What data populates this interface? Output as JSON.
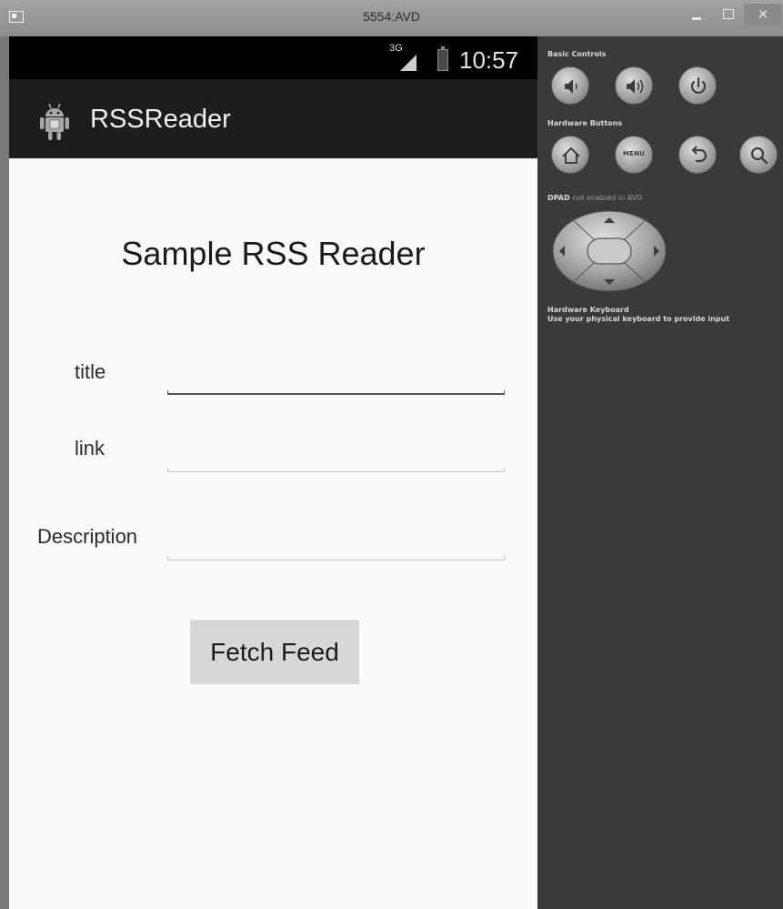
{
  "window": {
    "title": "5554:AVD",
    "close_glyph": "×"
  },
  "device": {
    "status_bar": {
      "network": "3G",
      "time": "10:57"
    },
    "action_bar": {
      "app_title": "RSSReader",
      "icon": "android-robot-icon"
    },
    "heading": "Sample RSS Reader",
    "form": {
      "fields": [
        {
          "label": "title",
          "value": ""
        },
        {
          "label": "link",
          "value": ""
        },
        {
          "label": "Description",
          "value": ""
        }
      ],
      "fetch_button_label": "Fetch Feed"
    }
  },
  "controls": {
    "basic_controls_label": "Basic Controls",
    "hardware_buttons_label": "Hardware Buttons",
    "dpad_label": "DPAD",
    "dpad_note": "not enabled in AVD",
    "keyboard_label": "Hardware Keyboard",
    "keyboard_note": "Use your physical keyboard to provide input",
    "menu_label": "MENU",
    "basic_buttons": [
      "volume-down-icon",
      "volume-up-icon",
      "power-icon"
    ],
    "hardware_buttons": [
      "home-icon",
      "menu-icon",
      "back-icon",
      "search-icon"
    ]
  },
  "colors": {
    "device_background": "#fafafa",
    "action_bar": "#1d1d1d",
    "panel": "#3a3a3a",
    "button": "#d7d7d7"
  }
}
